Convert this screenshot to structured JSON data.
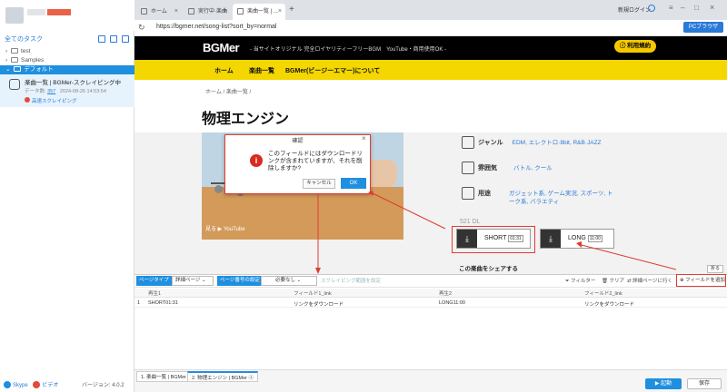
{
  "left_panel": {
    "tasks_header": "全てのタスク",
    "tree": [
      {
        "label": "test"
      },
      {
        "label": "Samples"
      },
      {
        "label": "デフォルト"
      }
    ],
    "task": {
      "title": "楽曲一覧 | BGMer-スクレイピング中",
      "meta_label": "データ数:",
      "count": "357",
      "time": "2024-08-26 14:53:54",
      "link": "高速スクレイピング"
    },
    "footer": {
      "skype": "Skype",
      "video": "ビデオ",
      "version": "バージョン: 4.0.2"
    }
  },
  "browser": {
    "tabs": [
      {
        "label": "ホーム"
      },
      {
        "label": "実行中·楽曲"
      },
      {
        "label": "楽曲一覧 | ..."
      }
    ],
    "url": "https://bgmer.net/song-list?sort_by=normal",
    "login": "新規ログイン",
    "pc_button": "PCブラウザ"
  },
  "site": {
    "logo": "BGMer",
    "tagline": "- 当サイトオリジナル 完全ロイヤリティーフリーBGM　YouTube・商用使用OK -",
    "register": "利用規約",
    "nav": [
      "ホーム",
      "楽曲一覧",
      "BGMer(ビージーエマー)について"
    ],
    "breadcrumb": "ホーム / 楽曲一覧 /",
    "title": "物理エンジン",
    "video_caption": "見る ▶ YouTube",
    "info": [
      {
        "label": "ジャンル",
        "value": "EDM, エレクトロ·8bit, R&B·JAZZ"
      },
      {
        "label": "雰囲気",
        "value": "バトル, クール"
      },
      {
        "label": "用途",
        "value": "ガジェット系, ゲーム実況, スポーツ, トーク系, バラエティ"
      }
    ],
    "downloads_label": "521 DL",
    "short_label": "SHORT",
    "short_time": "01:31",
    "long_label": "LONG",
    "long_time": "11:00",
    "share": "この楽曲をシェアする",
    "collapse": "折る"
  },
  "dialog": {
    "title": "確認",
    "message": "このフィールドにはダウンロードリンクが含まれていますが、それを削除しますか?",
    "cancel": "キャンセル",
    "ok": "OK"
  },
  "toolbar": {
    "page_type_label": "ページタイプ",
    "page_type_value": "詳細ページ",
    "page_no_label": "ページ番号の設定",
    "page_no_value": "必要なし",
    "scrape_range": "スクレイピング範囲を設定",
    "filter": "フィルター",
    "clear": "クリア",
    "open_detail": "詳細ページに行く",
    "add_field": "フィールドを追加"
  },
  "grid": {
    "headers": [
      "再生1",
      "フィールド1_link",
      "再生2",
      "フィールド2_link"
    ],
    "rows": [
      {
        "index": "1",
        "c1": "SHORT01:31",
        "c2": "リンクをダウンロード",
        "c3": "LONG11:00",
        "c4": "リンクをダウンロード"
      }
    ]
  },
  "bottom": {
    "tab1": "1. 楽曲一覧 | BGMer",
    "tab2": "2. 物理エンジン | BGMer",
    "start": "▶ 起動",
    "save": "保存"
  }
}
